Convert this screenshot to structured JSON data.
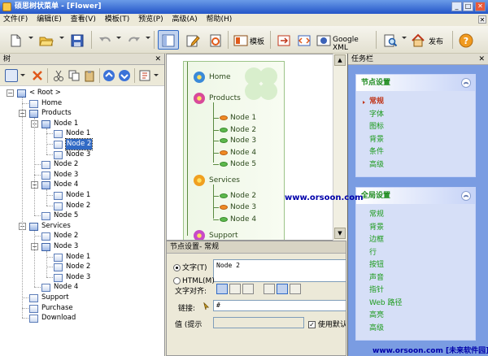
{
  "app": {
    "title": "硕思树状菜单 - [Flower]",
    "window_controls": [
      "_",
      "□",
      "✕"
    ]
  },
  "menubar": {
    "items": [
      "文件(F)",
      "编辑(E)",
      "查看(V)",
      "模板(T)",
      "预览(P)",
      "高级(A)",
      "帮助(H)"
    ]
  },
  "toolbar": {
    "template_label": "模板",
    "google_xml_label": "Google XML",
    "publish_label": "发布"
  },
  "left_panel": {
    "title": "树",
    "close": "✕",
    "tree": [
      {
        "label": "< Root >",
        "level": 0,
        "type": "group",
        "expanded": true
      },
      {
        "label": "Home",
        "level": 1,
        "type": "item"
      },
      {
        "label": "Products",
        "level": 1,
        "type": "group",
        "expanded": true
      },
      {
        "label": "Node 1",
        "level": 2,
        "type": "group",
        "expanded": true
      },
      {
        "label": "Node 1",
        "level": 3,
        "type": "item"
      },
      {
        "label": "Node 2",
        "level": 3,
        "type": "item",
        "selected": true
      },
      {
        "label": "Node 3",
        "level": 3,
        "type": "item"
      },
      {
        "label": "Node 2",
        "level": 2,
        "type": "item"
      },
      {
        "label": "Node 3",
        "level": 2,
        "type": "item"
      },
      {
        "label": "Node 4",
        "level": 2,
        "type": "group",
        "expanded": true
      },
      {
        "label": "Node 1",
        "level": 3,
        "type": "item"
      },
      {
        "label": "Node 2",
        "level": 3,
        "type": "item"
      },
      {
        "label": "Node 5",
        "level": 2,
        "type": "item"
      },
      {
        "label": "Services",
        "level": 1,
        "type": "group",
        "expanded": true
      },
      {
        "label": "Node 2",
        "level": 2,
        "type": "item"
      },
      {
        "label": "Node 3",
        "level": 2,
        "type": "group",
        "expanded": true
      },
      {
        "label": "Node 1",
        "level": 3,
        "type": "item"
      },
      {
        "label": "Node 2",
        "level": 3,
        "type": "item"
      },
      {
        "label": "Node 3",
        "level": 3,
        "type": "item"
      },
      {
        "label": "Node 4",
        "level": 2,
        "type": "item"
      },
      {
        "label": "Support",
        "level": 1,
        "type": "item"
      },
      {
        "label": "Purchase",
        "level": 1,
        "type": "item"
      },
      {
        "label": "Download",
        "level": 1,
        "type": "item"
      }
    ]
  },
  "preview": {
    "nodes": [
      {
        "label": "Home",
        "kind": "flower",
        "color": "#3a8ad8"
      },
      {
        "label": "Products",
        "kind": "flower",
        "color": "#d84a9a"
      },
      {
        "label": "Node 1",
        "kind": "leaf-orange"
      },
      {
        "label": "Node 2",
        "kind": "leaf"
      },
      {
        "label": "Node 3",
        "kind": "leaf"
      },
      {
        "label": "Node 4",
        "kind": "leaf-orange"
      },
      {
        "label": "Node 5",
        "kind": "leaf"
      },
      {
        "label": "Services",
        "kind": "flower",
        "color": "#f0a020"
      },
      {
        "label": "Node 2",
        "kind": "leaf"
      },
      {
        "label": "Node 3",
        "kind": "leaf-orange"
      },
      {
        "label": "Node 4",
        "kind": "leaf"
      },
      {
        "label": "Support",
        "kind": "flower",
        "color": "#c84ac8"
      }
    ]
  },
  "properties": {
    "header": "节点设置- 常规",
    "text_label": "文字(T)",
    "text_value": "Node 2",
    "html_label": "HTML(M)",
    "align_label": "文字对齐:",
    "link_label": "链接:",
    "link_value": "#",
    "tooltip_label": "值 (提示",
    "use_default_label": "使用默认"
  },
  "task_panel": {
    "title": "任务栏",
    "close": "✕",
    "sections": [
      {
        "title": "节点设置",
        "items": [
          "常规",
          "字体",
          "图标",
          "背景",
          "条件",
          "高级"
        ],
        "active": 0
      },
      {
        "title": "全局设置",
        "items": [
          "常规",
          "背景",
          "边框",
          "行",
          "按钮",
          "声音",
          "指针",
          "Web 路径",
          "高亮",
          "高级"
        ]
      }
    ]
  },
  "watermarks": {
    "top": "www.orsoon.com",
    "bottom": "www.orsoon.com [未来软件园]"
  },
  "colors": {
    "titlebar": "#2456c8",
    "selection": "#316ac5",
    "task_bg": "#7a9ce2",
    "task_item": "#1a9a1a",
    "task_active": "#c0361a",
    "watermark": "#0000aa"
  }
}
